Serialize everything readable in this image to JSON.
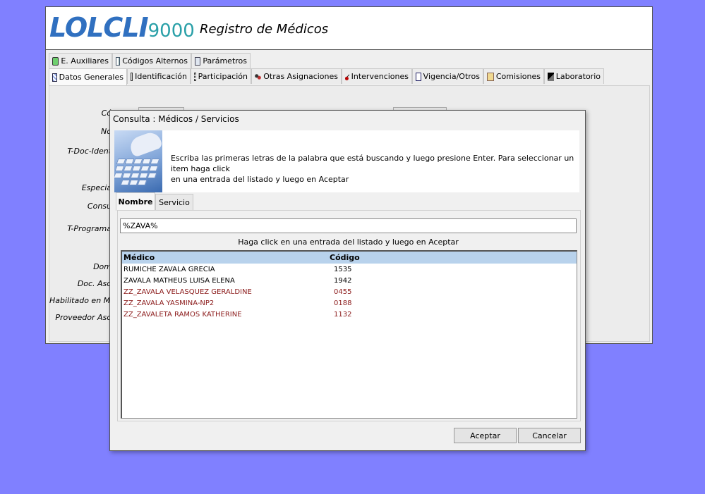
{
  "app": {
    "logo_text": "LOLCLI",
    "logo_num": "9000",
    "title": "Registro de Médicos"
  },
  "tabs_row1": [
    {
      "label": "E. Auxiliares",
      "icon": "green-shield-icon"
    },
    {
      "label": "Códigos Alternos",
      "icon": "table-icon"
    },
    {
      "label": "Parámetros",
      "icon": "parameters-icon"
    }
  ],
  "tabs_row2": [
    {
      "label": "Datos Generales",
      "icon": "general-data-icon",
      "active": true
    },
    {
      "label": "Identificación",
      "icon": "id-card-icon"
    },
    {
      "label": "Participación",
      "icon": "participation-icon"
    },
    {
      "label": "Otras Asignaciones",
      "icon": "people-icon"
    },
    {
      "label": "Intervenciones",
      "icon": "scissors-icon"
    },
    {
      "label": "Vigencia/Otros",
      "icon": "checklist-icon"
    },
    {
      "label": "Comisiones",
      "icon": "coins-icon"
    },
    {
      "label": "Laboratorio",
      "icon": "lab-icon"
    }
  ],
  "form_labels": {
    "l1": "Có",
    "l2": "No",
    "l3": "T-Doc-Ident",
    "l4": "Especia",
    "l5": "Consu",
    "l6": "T-Programa",
    "l7": "Dom",
    "l8": "Doc. Aso",
    "l9": "Habilitado en Mó",
    "l10": "Proveedor Aso"
  },
  "dialog": {
    "title": "Consulta : Médicos / Servicios",
    "instructions_line1": "Escriba las primeras letras de la palabra que está buscando y luego presione Enter. Para seleccionar un item haga click",
    "instructions_line2": "en una entrada del listado y luego en Aceptar",
    "tabs": [
      {
        "label": "Nombre",
        "active": true
      },
      {
        "label": "Servicio",
        "active": false
      }
    ],
    "search_value": "%ZAVA%",
    "hint": "Haga click en una entrada del listado y luego en  Aceptar",
    "columns": [
      "Médico",
      "Código"
    ],
    "rows": [
      {
        "name": "RUMICHE ZAVALA GRECIA",
        "code": "1535",
        "color": "#000000"
      },
      {
        "name": "ZAVALA MATHEUS LUISA ELENA",
        "code": "1942",
        "color": "#000000"
      },
      {
        "name": "ZZ_ZAVALA VELASQUEZ GERALDINE",
        "code": "0455",
        "color": "#8b1a1a"
      },
      {
        "name": "ZZ_ZAVALA YASMINA-NP2",
        "code": "0188",
        "color": "#8b1a1a"
      },
      {
        "name": "ZZ_ZAVALETA RAMOS KATHERINE",
        "code": "1132",
        "color": "#8b1a1a"
      }
    ],
    "buttons": {
      "accept": "Aceptar",
      "cancel": "Cancelar"
    }
  }
}
